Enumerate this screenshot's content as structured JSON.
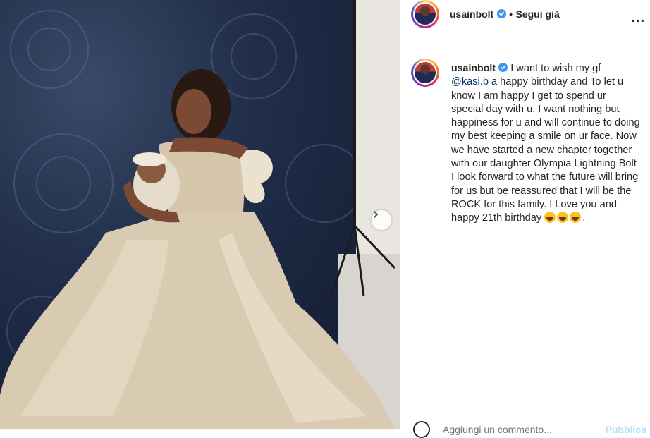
{
  "post": {
    "username": "usainbolt",
    "verified_icon": "verified-badge-icon",
    "follow_separator": "•",
    "follow_label": "Segui già",
    "more_icon": "more-options-icon",
    "more_label": "...",
    "next_icon": "chevron-right-icon"
  },
  "caption": {
    "username": "usainbolt",
    "text_before_mention": "I want to wish my gf",
    "mention": "@kasi.b",
    "text_after_mention": "a happy birthday and To let u know I am happy I get to spend ur special day with u. I want nothing but happiness for u and will continue to doing my best keeping a smile on ur face. Now we have started a new chapter together with our daughter Olympia Lightning Bolt I look forward to what the future will bring for us but be reassured that I will be the ROCK for this family. I Love you and happy 21th birthday",
    "emojis": [
      "grinning-squinting-face",
      "grinning-squinting-face",
      "grinning-squinting-face"
    ],
    "trailing": "."
  },
  "comment": {
    "placeholder": "Aggiungi un commento...",
    "post_label": "Pubblica",
    "emoji_icon": "smiley-icon"
  },
  "colors": {
    "verified_blue": "#3897f0",
    "mention_blue": "#00376b",
    "post_button": "#b2dffc",
    "text": "#262626"
  }
}
